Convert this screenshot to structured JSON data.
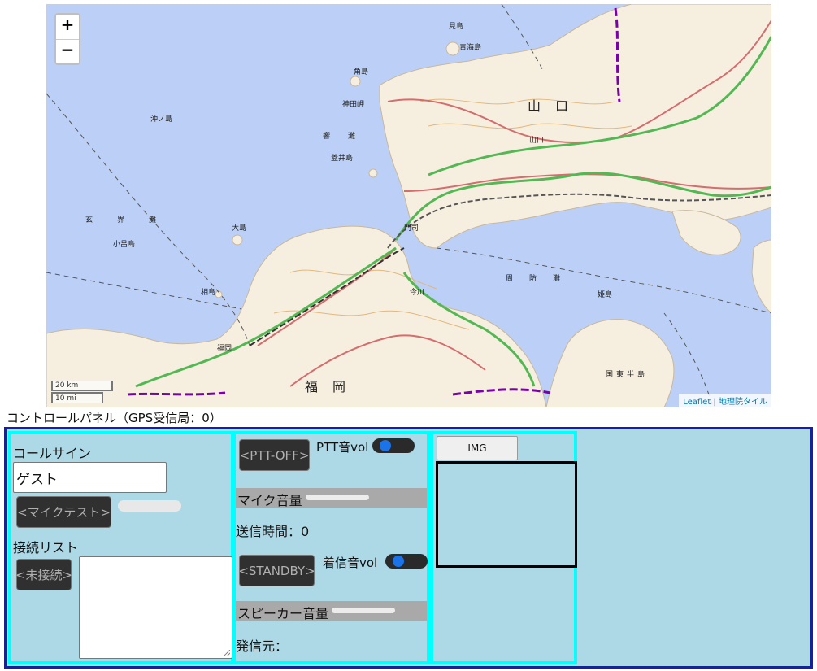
{
  "map": {
    "zoom_in": "+",
    "zoom_out": "−",
    "scale_km": "20 km",
    "scale_mi": "10 mi",
    "attribution_leaflet": "Leaflet",
    "attribution_sep": " | ",
    "attribution_gsi": "地理院タイル",
    "labels": {
      "yamaguchi": "山口",
      "fukuoka": "福岡",
      "genkainada": "玄界灘",
      "hibikinada": "響灘",
      "suonada": "周防灘",
      "okinoshima": "沖ノ島",
      "oshima": "大島",
      "aijima": "相島",
      "kojima": "小呂島",
      "tsunoshima": "角島",
      "kandamisaki": "神田岬",
      "futaoijima": "蓋井島",
      "kunisaki": "国東半島",
      "himeshima": "姫島",
      "yamaguchi_city": "山口",
      "fukuoka_city": "福岡",
      "kanmon": "門司",
      "imagawa": "今川",
      "awashima": "青海島",
      "mishima": "見島"
    }
  },
  "panel": {
    "title": "コントロールパネル（GPS受信局：0）",
    "callsign_label": "コールサイン",
    "callsign_value": "ゲスト",
    "mic_test_button": "<マイクテスト>",
    "connection_list_label": "接続リスト",
    "unconnected_button": "<未接続>",
    "ptt_button": "<PTT-OFF>",
    "ptt_vol_label": "PTT音vol",
    "mic_volume_label": "マイク音量",
    "send_time_label": "送信時間：0",
    "standby_button": "<STANDBY>",
    "ring_vol_label": "着信音vol",
    "speaker_volume_label": "スピーカー音量",
    "caller_label": "発信元：",
    "img_button": "IMG"
  },
  "colors": {
    "panel_border": "#1717cf",
    "column_border": "#00ffff",
    "panel_bg": "#add8e6",
    "sea": "#bcd0f7",
    "land": "#f6efe0",
    "expressway": "#53b853",
    "prefecture_border": "#7a00a8"
  }
}
